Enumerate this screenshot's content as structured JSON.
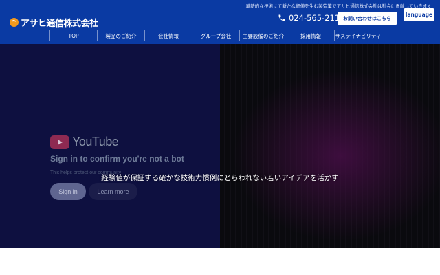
{
  "header": {
    "tagline": "革新的な技術にて新たな価値を生む製造業でアサヒ通信株式会社は社会に貢献していきます",
    "logo_text": "アサヒ通信株式会社",
    "phone": "024-565-2111",
    "contact_label": "お問い合わせはこちら",
    "language_label": "language",
    "colors": {
      "bar": "#0a3aa3",
      "logo_accent": "#f39a1e"
    }
  },
  "nav": {
    "items": [
      {
        "label": "TOP"
      },
      {
        "label": "製品のご紹介"
      },
      {
        "label": "会社情報"
      },
      {
        "label": "グループ会社"
      },
      {
        "label": "主要設備のご紹介"
      },
      {
        "label": "採用情報"
      },
      {
        "label": "サステイナビリティ"
      }
    ]
  },
  "hero": {
    "caption": "経験値が保証する確かな技術力慣例にとらわれない若いアイデアを活かす",
    "youtube": {
      "brand": "YouTube",
      "title": "Sign in to confirm you're not a bot",
      "subtitle": "This helps protect our community",
      "signin_label": "Sign in",
      "learn_label": "Learn more"
    }
  }
}
